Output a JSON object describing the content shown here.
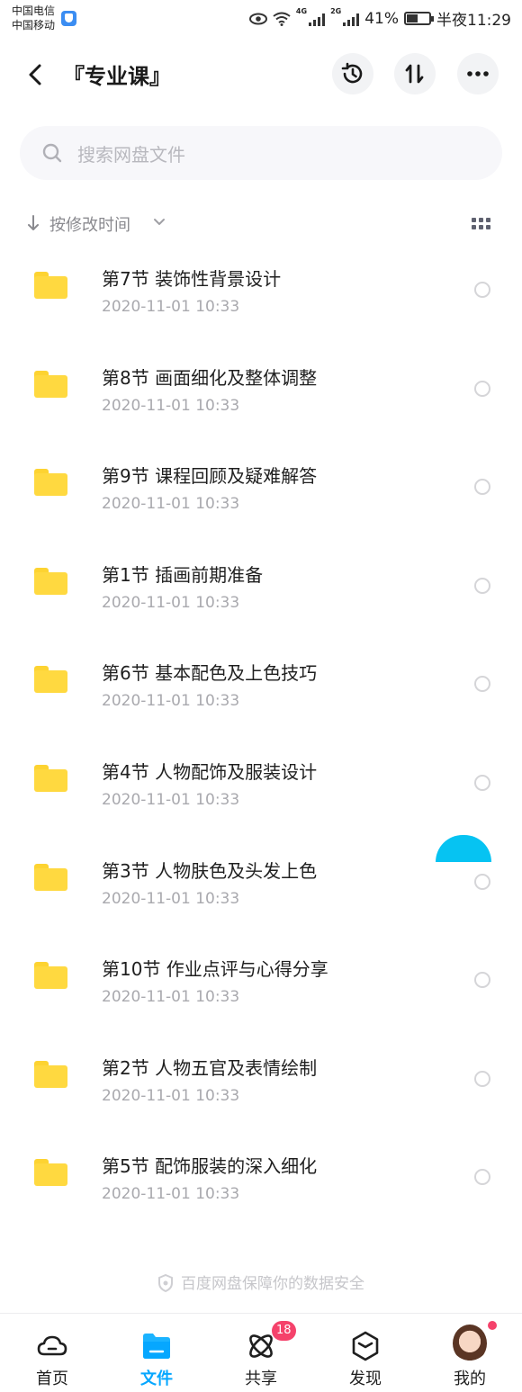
{
  "status_bar": {
    "carrier_1": "中国电信",
    "carrier_2": "中国移动",
    "net_4g": "4G",
    "net_2g": "2G",
    "battery": "41%",
    "time": "半夜11:29"
  },
  "header": {
    "title": "『专业课』"
  },
  "search": {
    "placeholder": "搜索网盘文件"
  },
  "sort": {
    "label": "按修改时间"
  },
  "files": [
    {
      "name": "第7节 装饰性背景设计",
      "date": "2020-11-01  10:33"
    },
    {
      "name": "第8节 画面细化及整体调整",
      "date": "2020-11-01  10:33"
    },
    {
      "name": "第9节 课程回顾及疑难解答",
      "date": "2020-11-01  10:33"
    },
    {
      "name": "第1节 插画前期准备",
      "date": "2020-11-01  10:33"
    },
    {
      "name": "第6节 基本配色及上色技巧",
      "date": "2020-11-01  10:33"
    },
    {
      "name": "第4节 人物配饰及服装设计",
      "date": "2020-11-01  10:33"
    },
    {
      "name": "第3节 人物肤色及头发上色",
      "date": "2020-11-01  10:33"
    },
    {
      "name": "第10节 作业点评与心得分享",
      "date": "2020-11-01  10:33"
    },
    {
      "name": "第2节 人物五官及表情绘制",
      "date": "2020-11-01  10:33"
    },
    {
      "name": "第5节 配饰服装的深入细化",
      "date": "2020-11-01  10:33"
    }
  ],
  "footer_note": "百度网盘保障你的数据安全",
  "tabs": [
    {
      "label": "首页",
      "icon": "cloud-icon"
    },
    {
      "label": "文件",
      "icon": "folder-icon"
    },
    {
      "label": "共享",
      "icon": "atom-icon"
    },
    {
      "label": "发现",
      "icon": "cube-icon"
    },
    {
      "label": "我的",
      "icon": "avatar"
    }
  ],
  "share_badge": "18",
  "colors": {
    "accent": "#06a7ff",
    "folder": "#ffd940",
    "badge": "#f5426b"
  }
}
